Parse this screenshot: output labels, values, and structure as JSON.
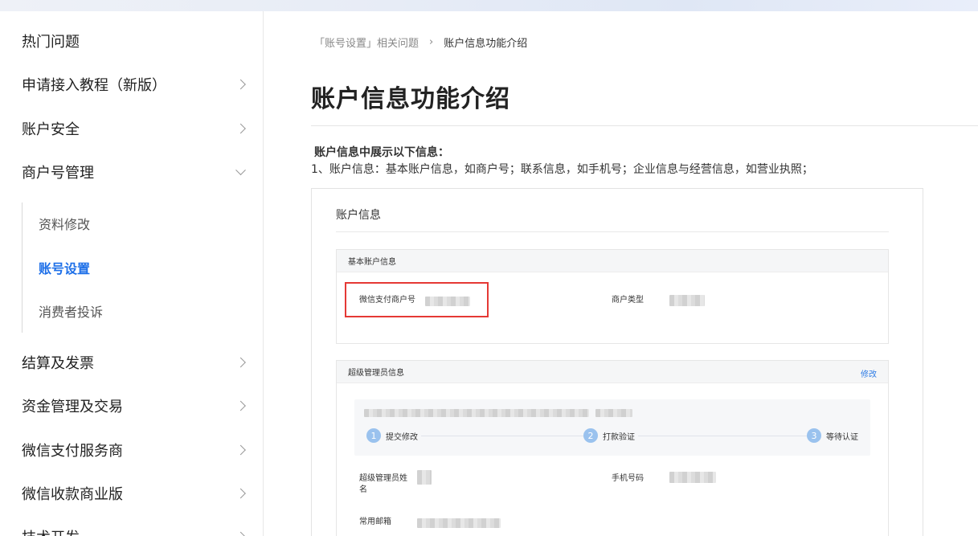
{
  "sidebar": {
    "items": [
      {
        "label": "热门问题"
      },
      {
        "label": "申请接入教程（新版）"
      },
      {
        "label": "账户安全"
      },
      {
        "label": "商户号管理"
      },
      {
        "label": "结算及发票"
      },
      {
        "label": "资金管理及交易"
      },
      {
        "label": "微信支付服务商"
      },
      {
        "label": "微信收款商业版"
      },
      {
        "label": "技术开发"
      }
    ],
    "sub_items": [
      {
        "label": "资料修改"
      },
      {
        "label": "账号设置"
      },
      {
        "label": "消费者投诉"
      }
    ],
    "active_sub": "账号设置"
  },
  "breadcrumb": {
    "parent": "「账号设置」相关问题",
    "separator": "›",
    "current": "账户信息功能介绍"
  },
  "page": {
    "title": "账户信息功能介绍",
    "intro_heading": "账户信息中展示以下信息：",
    "intro_line": "1、账户信息：基本账户信息，如商户号；联系信息，如手机号；企业信息与经营信息，如营业执照；"
  },
  "screenshot": {
    "title": "账户信息",
    "basic_card": {
      "heading": "基本账户信息",
      "merchant_id_label": "微信支付商户号",
      "merchant_type_label": "商户类型"
    },
    "admin_card": {
      "heading": "超级管理员信息",
      "edit_label": "修改",
      "steps": [
        {
          "num": "1",
          "label": "提交修改"
        },
        {
          "num": "2",
          "label": "打款验证"
        },
        {
          "num": "3",
          "label": "等待认证"
        }
      ],
      "name_label": "超级管理员姓名",
      "phone_label": "手机号码",
      "email_label": "常用邮箱"
    }
  },
  "colors": {
    "accent": "#1d6fe8",
    "highlight_box": "#e53935",
    "step_circle": "#9ac2ee"
  }
}
